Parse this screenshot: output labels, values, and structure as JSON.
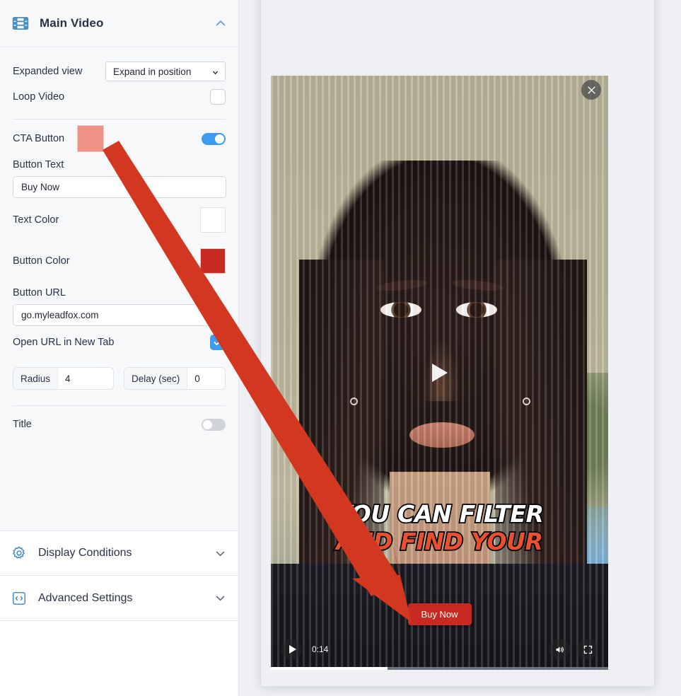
{
  "panel": {
    "title": "Main Video",
    "icon": "film-strip-icon",
    "collapse_icon": "chevron-up-icon",
    "fields": {
      "expanded_view_label": "Expanded view",
      "expanded_view_value": "Expand in position",
      "loop_video_label": "Loop Video",
      "loop_video_checked": false,
      "cta_button_label": "CTA Button",
      "cta_button_toggle_on": true,
      "cta_swatch_color": "#ef9184",
      "button_text_label": "Button Text",
      "button_text_value": "Buy Now",
      "text_color_label": "Text Color",
      "text_color_value": "#ffffff",
      "button_color_label": "Button Color",
      "button_color_value": "#c62a20",
      "button_url_label": "Button URL",
      "button_url_value": "go.myleadfox.com",
      "open_new_tab_label": "Open URL in New Tab",
      "open_new_tab_checked": true,
      "radius_label": "Radius",
      "radius_value": "4",
      "delay_label": "Delay (sec)",
      "delay_value": "0",
      "title_label": "Title",
      "title_toggle_on": false
    }
  },
  "sections": [
    {
      "label": "Display Conditions",
      "icon": "gear-icon",
      "chevron": "chevron-down-icon"
    },
    {
      "label": "Advanced Settings",
      "icon": "code-icon",
      "chevron": "chevron-down-icon"
    }
  ],
  "preview": {
    "close_icon": "close-icon",
    "play_icon": "play-icon",
    "caption_line1": "YOU CAN FILTER",
    "caption_line2": "AND FIND YOUR",
    "cta_overlay_label": "Buy Now",
    "current_time": "0:14",
    "volume_icon": "volume-icon",
    "fullscreen_icon": "fullscreen-icon",
    "progress_percent": 34.5
  },
  "annotation": {
    "type": "arrow",
    "color": "#d1381f",
    "from": "cta-color-swatch",
    "to": "cta-overlay-button"
  }
}
